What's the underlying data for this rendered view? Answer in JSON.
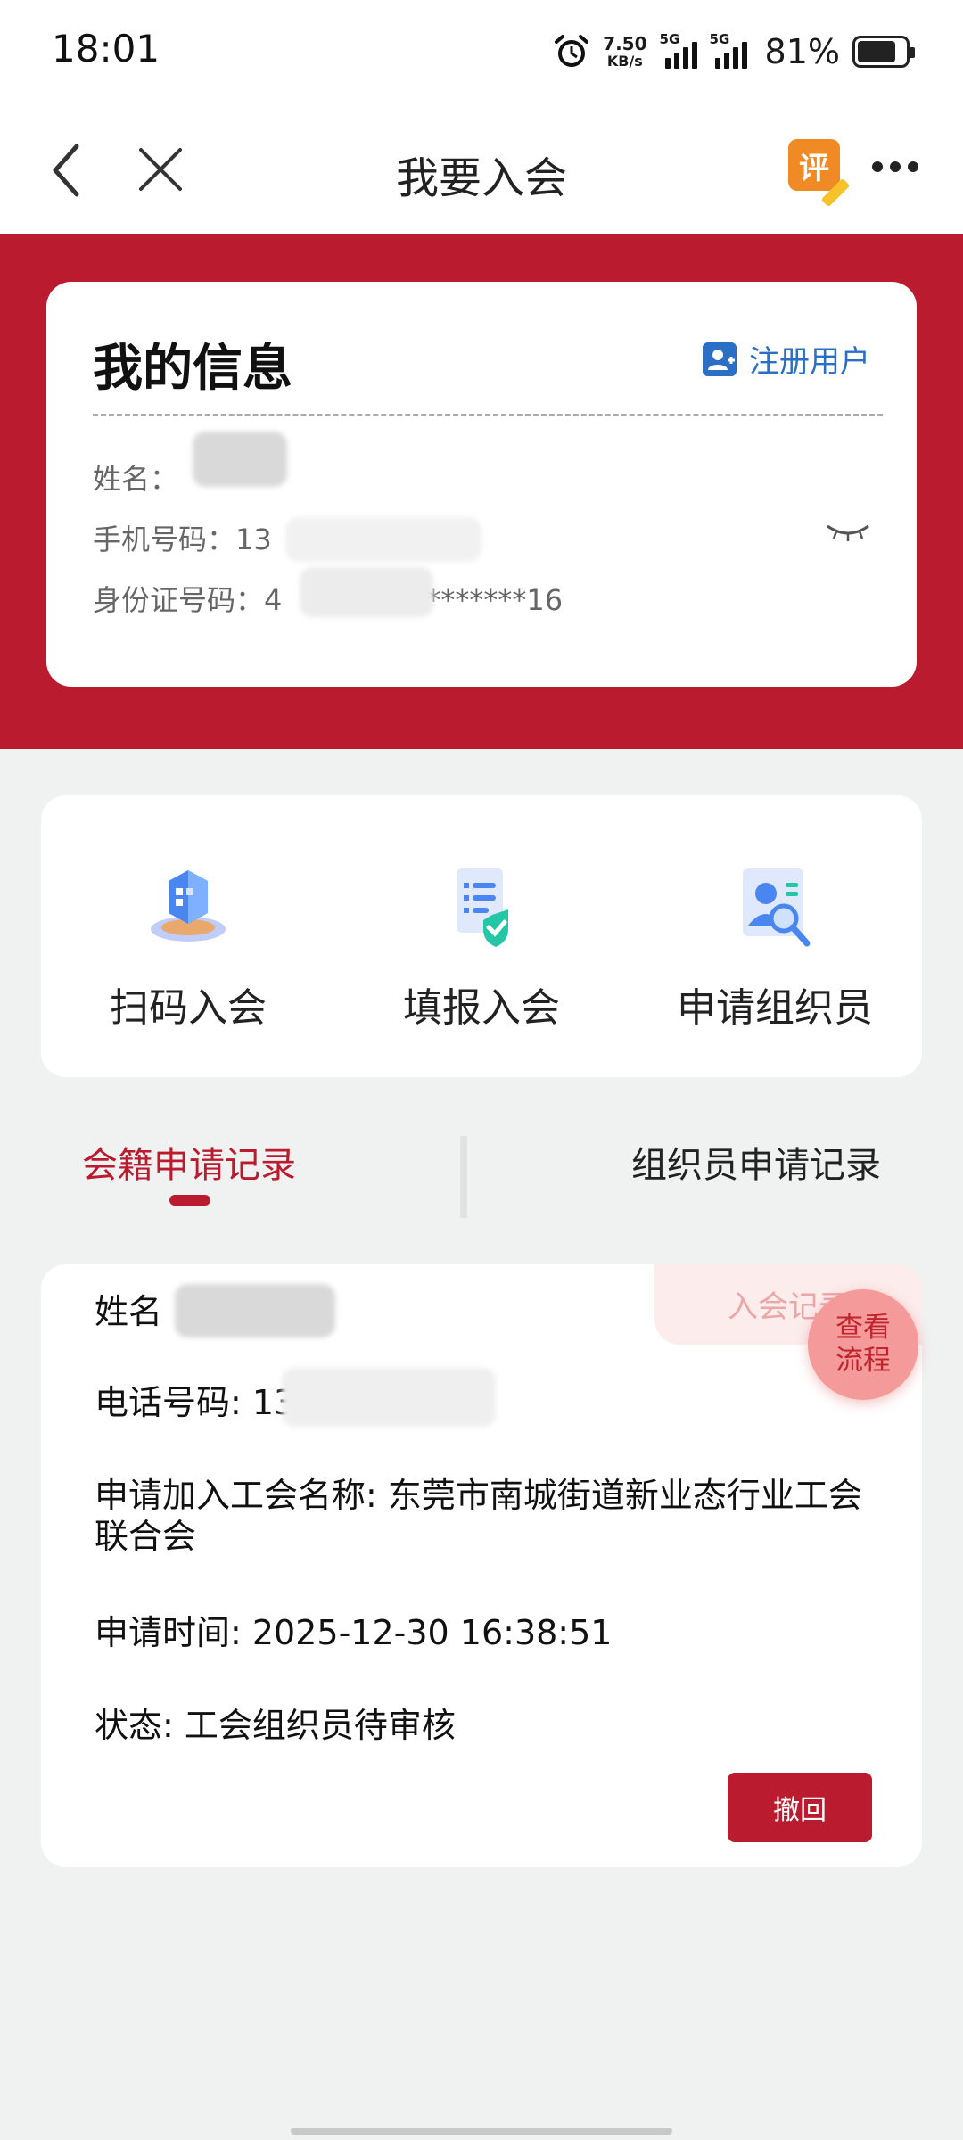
{
  "status_bar": {
    "time": "18:01",
    "speed_value": "7.50",
    "speed_unit": "KB/s",
    "sim1": "5G",
    "sim2": "5G",
    "battery": "81%"
  },
  "nav": {
    "title": "我要入会",
    "rate_label": "评"
  },
  "my_info": {
    "title": "我的信息",
    "register_label": "注册用户",
    "name_label": "姓名：",
    "phone_label": "手机号码：",
    "phone_value": "13",
    "id_label": "身份证号码：",
    "id_value": "4",
    "id_value_tail": "*********16"
  },
  "actions": [
    {
      "label": "扫码入会",
      "icon": "scan-join-icon"
    },
    {
      "label": "填报入会",
      "icon": "form-join-icon"
    },
    {
      "label": "申请组织员",
      "icon": "organizer-apply-icon"
    }
  ],
  "tabs": {
    "left": "会籍申请记录",
    "right": "组织员申请记录"
  },
  "record": {
    "badge": "入会记录",
    "name_label": "姓名",
    "phone_label": "电话号码: 13",
    "union_label": "申请加入工会名称: 东莞市南城街道新业态行业工会联合会",
    "time_label": "申请时间: 2025-12-30 16:38:51",
    "status_label": "状态: 工会组织员待审核",
    "withdraw": "撤回"
  },
  "flow_button": "查看\n流程",
  "colors": {
    "brand_red": "#ba1b2e",
    "link_blue": "#2a6fc4",
    "background": "#f0f1f1"
  }
}
